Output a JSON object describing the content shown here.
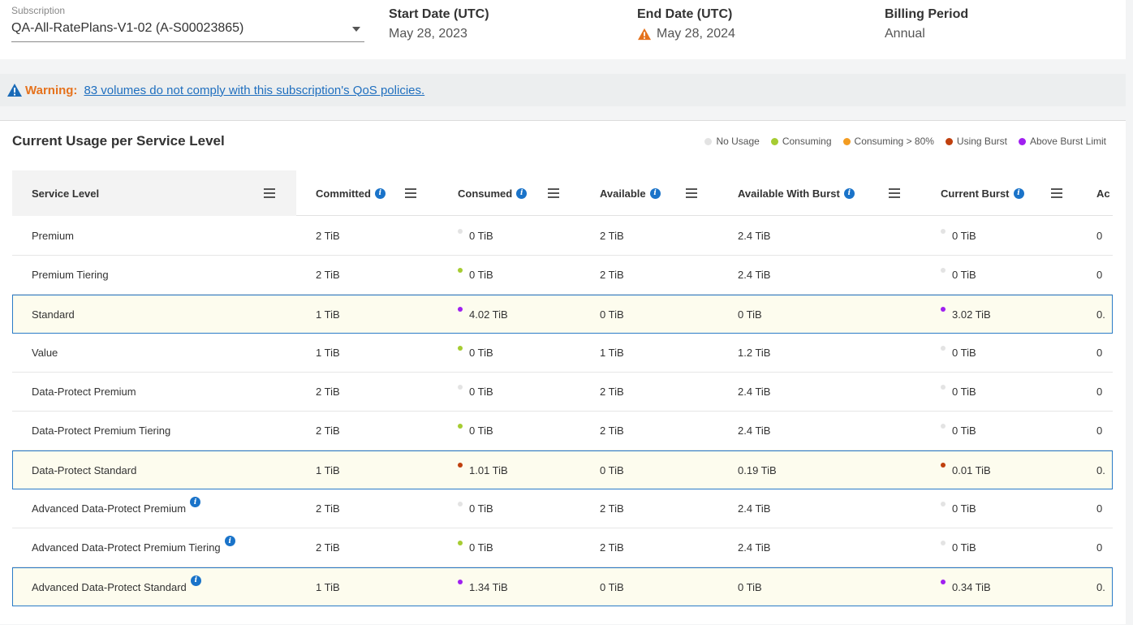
{
  "subscription": {
    "label": "Subscription",
    "value": "QA-All-RatePlans-V1-02 (A-S00023865)"
  },
  "start_date": {
    "label": "Start Date (UTC)",
    "value": "May 28, 2023"
  },
  "end_date": {
    "label": "End Date (UTC)",
    "value": "May 28, 2024"
  },
  "billing_period": {
    "label": "Billing Period",
    "value": "Annual"
  },
  "warning": {
    "label": "Warning:",
    "link": "83 volumes do not comply with this subscription's QoS policies."
  },
  "usage": {
    "title": "Current Usage per Service Level",
    "legend": [
      {
        "label": "No Usage",
        "color": "#e3e3e3"
      },
      {
        "label": "Consuming",
        "color": "#a6cc32"
      },
      {
        "label": "Consuming > 80%",
        "color": "#f39c21"
      },
      {
        "label": "Using Burst",
        "color": "#c0400e"
      },
      {
        "label": "Above Burst Limit",
        "color": "#a020f0"
      }
    ],
    "columns": [
      "Service Level",
      "Committed",
      "Consumed",
      "Available",
      "Available With Burst",
      "Current Burst",
      "Ac"
    ],
    "rows": [
      {
        "name": "Premium",
        "committed": "2 TiB",
        "consumed": "0 TiB",
        "consumed_status": "#e3e3e3",
        "available": "2 TiB",
        "avail_burst": "2.4 TiB",
        "current_burst": "0 TiB",
        "burst_status": "#e3e3e3",
        "ac": "0",
        "highlight": false,
        "info": false
      },
      {
        "name": "Premium Tiering",
        "committed": "2 TiB",
        "consumed": "0 TiB",
        "consumed_status": "#a6cc32",
        "available": "2 TiB",
        "avail_burst": "2.4 TiB",
        "current_burst": "0 TiB",
        "burst_status": "#e3e3e3",
        "ac": "0",
        "highlight": false,
        "info": false
      },
      {
        "name": "Standard",
        "committed": "1 TiB",
        "consumed": "4.02 TiB",
        "consumed_status": "#a020f0",
        "available": "0 TiB",
        "avail_burst": "0 TiB",
        "current_burst": "3.02 TiB",
        "burst_status": "#a020f0",
        "ac": "0.",
        "highlight": true,
        "info": false
      },
      {
        "name": "Value",
        "committed": "1 TiB",
        "consumed": "0 TiB",
        "consumed_status": "#a6cc32",
        "available": "1 TiB",
        "avail_burst": "1.2 TiB",
        "current_burst": "0 TiB",
        "burst_status": "#e3e3e3",
        "ac": "0",
        "highlight": false,
        "info": false
      },
      {
        "name": "Data-Protect Premium",
        "committed": "2 TiB",
        "consumed": "0 TiB",
        "consumed_status": "#e3e3e3",
        "available": "2 TiB",
        "avail_burst": "2.4 TiB",
        "current_burst": "0 TiB",
        "burst_status": "#e3e3e3",
        "ac": "0",
        "highlight": false,
        "info": false
      },
      {
        "name": "Data-Protect Premium Tiering",
        "committed": "2 TiB",
        "consumed": "0 TiB",
        "consumed_status": "#a6cc32",
        "available": "2 TiB",
        "avail_burst": "2.4 TiB",
        "current_burst": "0 TiB",
        "burst_status": "#e3e3e3",
        "ac": "0",
        "highlight": false,
        "info": false
      },
      {
        "name": "Data-Protect Standard",
        "committed": "1 TiB",
        "consumed": "1.01 TiB",
        "consumed_status": "#c0400e",
        "available": "0 TiB",
        "avail_burst": "0.19 TiB",
        "current_burst": "0.01 TiB",
        "burst_status": "#c0400e",
        "ac": "0.",
        "highlight": true,
        "info": false
      },
      {
        "name": "Advanced Data-Protect Premium",
        "committed": "2 TiB",
        "consumed": "0 TiB",
        "consumed_status": "#e3e3e3",
        "available": "2 TiB",
        "avail_burst": "2.4 TiB",
        "current_burst": "0 TiB",
        "burst_status": "#e3e3e3",
        "ac": "0",
        "highlight": false,
        "info": true
      },
      {
        "name": "Advanced Data-Protect Premium Tiering",
        "committed": "2 TiB",
        "consumed": "0 TiB",
        "consumed_status": "#a6cc32",
        "available": "2 TiB",
        "avail_burst": "2.4 TiB",
        "current_burst": "0 TiB",
        "burst_status": "#e3e3e3",
        "ac": "0",
        "highlight": false,
        "info": true
      },
      {
        "name": "Advanced Data-Protect Standard",
        "committed": "1 TiB",
        "consumed": "1.34 TiB",
        "consumed_status": "#a020f0",
        "available": "0 TiB",
        "avail_burst": "0 TiB",
        "current_burst": "0.34 TiB",
        "burst_status": "#a020f0",
        "ac": "0.",
        "highlight": true,
        "info": true
      }
    ]
  }
}
